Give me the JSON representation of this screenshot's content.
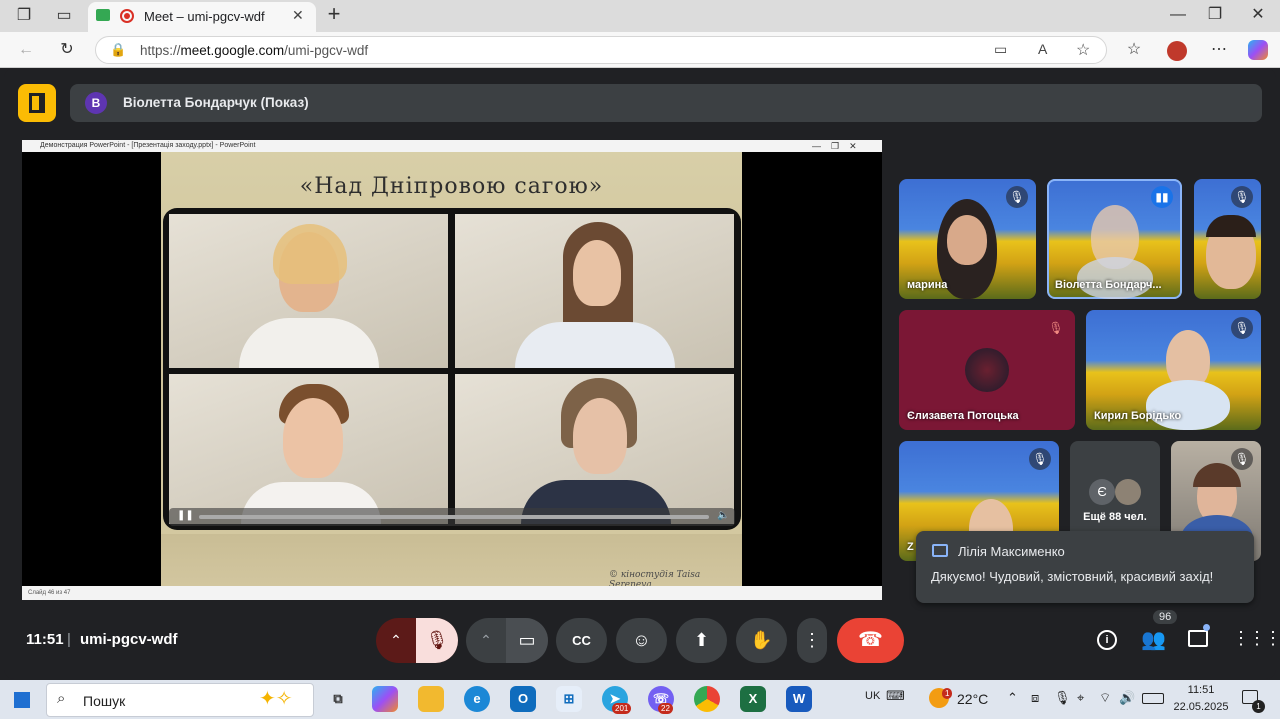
{
  "browser": {
    "tab_title": "Meet – umi-pgcv-wdf",
    "url_prefix": "https://",
    "url_host": "meet.google.com",
    "url_path": "/umi-pgcv-wdf",
    "new_tab": "+"
  },
  "meet": {
    "presenter_initial": "В",
    "presenter_label": "Віолетта Бондарчук (Показ)",
    "slide_title": "«Над Дніпровою сагою»",
    "slide_credit": "© кіностудія Taisa Sereneva",
    "ppt_window_title": "Демонстрация PowerPoint - [Презентація заходу.pptx] - PowerPoint",
    "ppt_slide_status": "Слайд 46 из 47",
    "tiles": [
      {
        "name": "марина"
      },
      {
        "name": "Віолетта Бондарч..."
      },
      {
        "name": ""
      },
      {
        "name": "Єлизавета Потоцька"
      },
      {
        "name": "Кирил Борідько"
      },
      {
        "name": "Z"
      },
      {
        "name": "Ещё 88 чел.",
        "avatar_letter": "Є"
      },
      {
        "name": ""
      }
    ],
    "toast": {
      "sender": "Лілія Максименко",
      "message": "Дякуємо! Чудовий, змістовний, красивий захід!"
    },
    "time": "11:51",
    "meeting_code": "umi-pgcv-wdf",
    "participants_count": "96"
  },
  "taskbar": {
    "search_placeholder": "Пошук",
    "lang": "UK",
    "weather": "22°C",
    "weather_badge": "1",
    "clock_time": "11:51",
    "clock_date": "22.05.2025",
    "telegram_badge": "201",
    "viber_badge": "22",
    "notif_count": "1"
  },
  "colors": {
    "meet_bg": "#202124",
    "hangup": "#ea4335",
    "mic_off_bg": "#f9dedc",
    "accent_blue": "#8ab4f8",
    "gate_yellow": "#fbbc04"
  }
}
